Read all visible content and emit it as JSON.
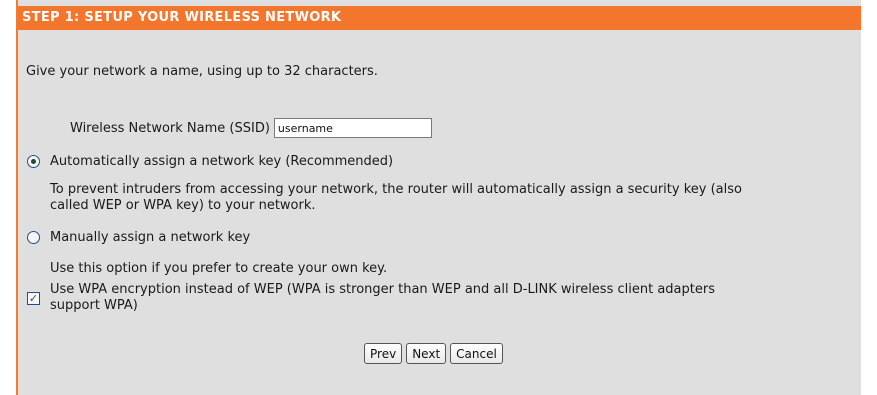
{
  "header": {
    "title": "STEP 1: SETUP YOUR WIRELESS NETWORK"
  },
  "intro": {
    "text": "Give your network a name, using up to 32 characters."
  },
  "ssid": {
    "label": "Wireless Network Name (SSID)",
    "value": "username"
  },
  "options": {
    "auto": {
      "label": "Automatically assign a network key (Recommended)",
      "selected": true,
      "description_line1": "To prevent intruders from accessing your network, the router will automatically assign a security key (also",
      "description_line2": "called WEP or WPA key) to your network."
    },
    "manual": {
      "label": "Manually assign a network key",
      "selected": false,
      "description": "Use this option if you prefer to create your own key."
    }
  },
  "wpa": {
    "checked": true,
    "label_line1": "Use WPA encryption instead of WEP (WPA is stronger than WEP and all D-LINK wireless client adapters",
    "label_line2": "support WPA)"
  },
  "buttons": {
    "prev": "Prev",
    "next": "Next",
    "cancel": "Cancel"
  },
  "colors": {
    "header_bg": "#f4762d",
    "panel_bg": "#dfdfdf",
    "accent_border": "#f07c2c"
  },
  "icons": {
    "radio_selected": "radio-selected-icon",
    "radio_unselected": "radio-unselected-icon",
    "checkbox_checked": "checkbox-checked-icon"
  }
}
